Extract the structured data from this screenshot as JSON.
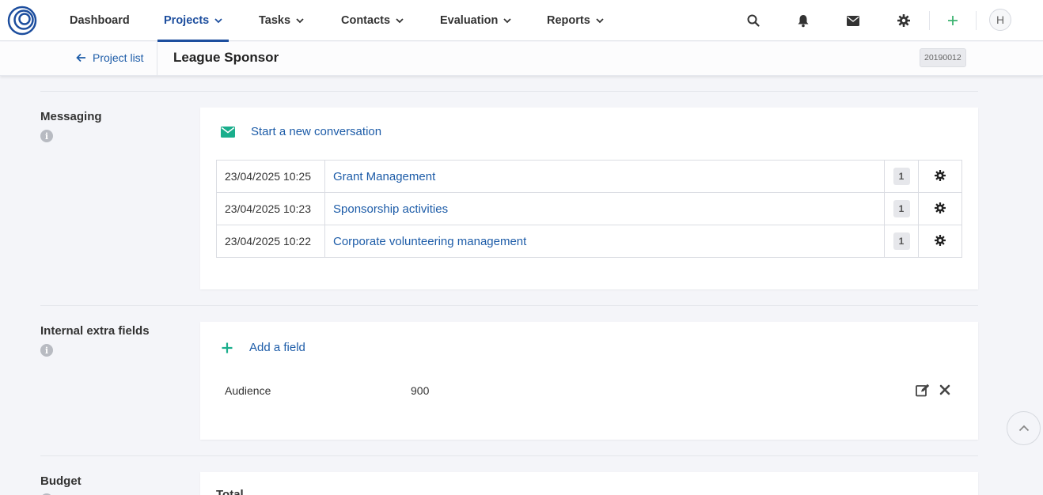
{
  "nav": {
    "items": [
      {
        "label": "Dashboard"
      },
      {
        "label": "Projects"
      },
      {
        "label": "Tasks"
      },
      {
        "label": "Contacts"
      },
      {
        "label": "Evaluation"
      },
      {
        "label": "Reports"
      }
    ],
    "avatar_initial": "H"
  },
  "subheader": {
    "back_label": "Project list",
    "title": "League Sponsor",
    "code": "20190012"
  },
  "messaging": {
    "section_label": "Messaging",
    "new_conversation_label": "Start a new conversation",
    "conversations": [
      {
        "date": "23/04/2025 10:25",
        "subject": "Grant Management",
        "count": "1"
      },
      {
        "date": "23/04/2025 10:23",
        "subject": "Sponsorship activities",
        "count": "1"
      },
      {
        "date": "23/04/2025 10:22",
        "subject": "Corporate volunteering management",
        "count": "1"
      }
    ]
  },
  "extra_fields": {
    "section_label": "Internal extra fields",
    "add_label": "Add a field",
    "fields": [
      {
        "name": "Audience",
        "value": "900"
      }
    ]
  },
  "budget": {
    "section_label": "Budget",
    "total_label": "Total"
  },
  "colors": {
    "accent_blue": "#1d4e9e",
    "link_blue": "#1d5ca8",
    "teal": "#1aae8c",
    "green_plus": "#3cb371"
  }
}
